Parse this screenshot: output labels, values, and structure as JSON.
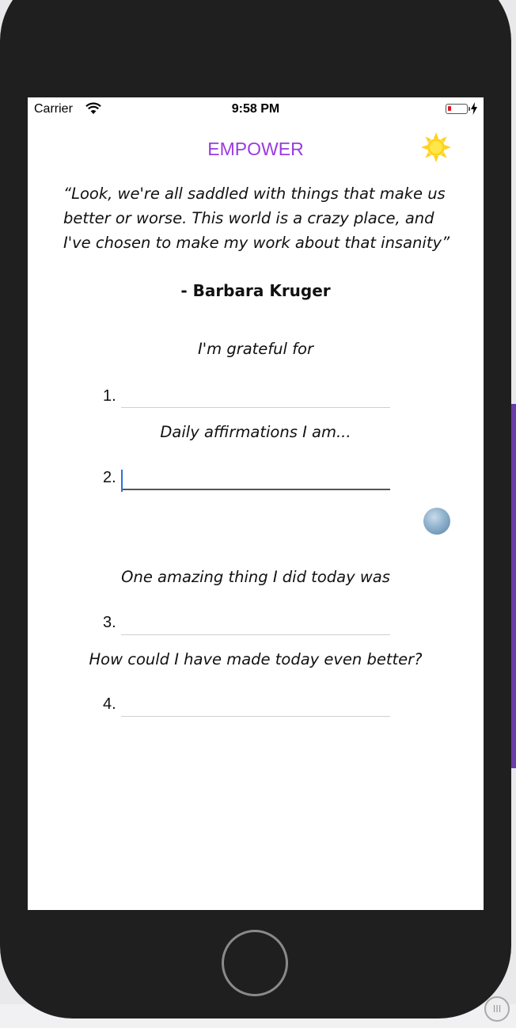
{
  "status_bar": {
    "carrier": "Carrier",
    "time": "9:58 PM",
    "wifi_icon": "wifi-icon",
    "battery_icon": "battery-icon",
    "charging_icon": "bolt-icon"
  },
  "header": {
    "title": "EMPOWER",
    "title_color": "#9a3be0",
    "theme_icon": "sun-icon"
  },
  "quote": {
    "text": "“Look, we're all saddled with things that make us better or worse. This world is a crazy place, and I've chosen to make my work about that insanity”",
    "author": "- Barbara Kruger"
  },
  "journal": {
    "sections": [
      {
        "prompt": "I'm grateful for",
        "number": "1.",
        "value": ""
      },
      {
        "prompt": "Daily affirmations I am...",
        "number": "2.",
        "value": ""
      },
      {
        "prompt": "One amazing thing I did today was",
        "number": "3.",
        "value": ""
      },
      {
        "prompt": "How could I have made today even better?",
        "number": "4.",
        "value": ""
      }
    ],
    "night_mode_icon": "moon-icon"
  }
}
